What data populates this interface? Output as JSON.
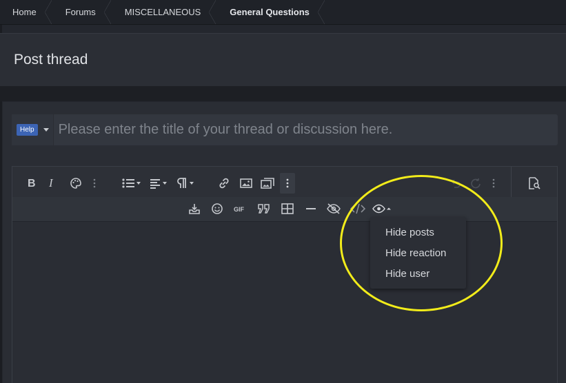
{
  "breadcrumb": [
    "Home",
    "Forums",
    "MISCELLANEOUS",
    "General Questions"
  ],
  "page_title": "Post thread",
  "prefix": {
    "badge": "Help"
  },
  "title_input": {
    "placeholder": "Please enter the title of your thread or discussion here.",
    "value": ""
  },
  "toolbar": {
    "row1_icons": [
      "bold-icon",
      "italic-icon",
      "palette-icon",
      "more-vertical-icon",
      "list-icon",
      "align-icon",
      "paragraph-icon",
      "link-icon",
      "image-icon",
      "media-icon",
      "more-vertical-icon",
      "undo-icon",
      "redo-icon",
      "more-vertical-icon",
      "preview-icon"
    ],
    "row2_icons": [
      "drafts-icon",
      "smilie-icon",
      "gif-icon",
      "quote-icon",
      "table-icon",
      "horizontal-rule-icon",
      "spoiler-icon",
      "code-icon",
      "hide-icon"
    ],
    "gif_label": "GIF"
  },
  "hide_menu": {
    "items": [
      "Hide posts",
      "Hide reaction",
      "Hide user"
    ]
  },
  "colors": {
    "highlight": "#f2ec1a",
    "badge": "#3c64b4",
    "background": "#24272e"
  }
}
